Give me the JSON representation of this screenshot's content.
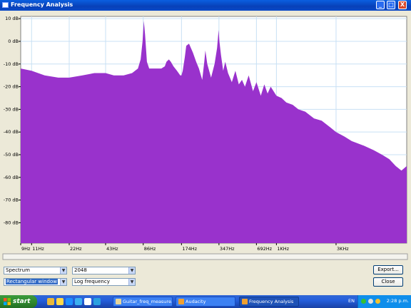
{
  "window": {
    "title": "Frequency Analysis",
    "minimize": "_",
    "maximize": "□",
    "close": "X"
  },
  "chart_data": {
    "type": "area",
    "title": "",
    "xlabel": "",
    "ylabel": "",
    "x_scale": "log",
    "x_unit": "Hz",
    "xlim": [
      9,
      11025
    ],
    "ylim": [
      -89,
      11
    ],
    "x_tick_values": [
      9,
      11,
      22,
      43,
      86,
      174,
      347,
      692,
      1000,
      3000
    ],
    "x_tick_labels": [
      "9Hz",
      "11Hz",
      "22Hz",
      "43Hz",
      "86Hz",
      "174Hz",
      "347Hz",
      "692Hz",
      "1KHz",
      "3KHz"
    ],
    "y_tick_values": [
      10,
      0,
      -10,
      -20,
      -30,
      -40,
      -50,
      -60,
      -70,
      -80
    ],
    "y_tick_labels": [
      "10 dB",
      "0 dB",
      "-10 dB",
      "-20 dB",
      "-30 dB",
      "-40 dB",
      "-50 dB",
      "-60 dB",
      "-70 dB",
      "-80 dB"
    ],
    "grid": true,
    "fill_color": "#9932CC",
    "background": "#FFFFFF",
    "grid_color": "#C8E0F4",
    "series": [
      {
        "x": [
          9,
          11,
          14,
          18,
          22,
          28,
          35,
          43,
          50,
          60,
          70,
          78,
          82,
          85,
          87,
          89,
          92,
          96,
          100,
          110,
          120,
          128,
          132,
          138,
          143,
          150,
          160,
          170,
          174,
          178,
          185,
          190,
          200,
          215,
          228,
          240,
          255,
          265,
          270,
          280,
          300,
          320,
          335,
          345,
          350,
          360,
          375,
          390,
          410,
          440,
          470,
          500,
          530,
          560,
          600,
          650,
          692,
          750,
          800,
          850,
          900,
          1000,
          1100,
          1200,
          1350,
          1500,
          1700,
          2000,
          2300,
          2700,
          3000,
          3500,
          4000,
          5000,
          6000,
          7000,
          8000,
          9000,
          10000,
          11025
        ],
        "y": [
          -12,
          -13,
          -15,
          -16,
          -16,
          -15,
          -14,
          -14,
          -15,
          -15,
          -14,
          -12,
          -8,
          0,
          9,
          3,
          -9,
          -12,
          -12,
          -12,
          -12,
          -11,
          -9,
          -8,
          -9,
          -11,
          -13,
          -15,
          -15,
          -13,
          -7,
          -2,
          -1,
          -5,
          -9,
          -12,
          -17,
          -9,
          -4,
          -10,
          -16,
          -10,
          -3,
          5,
          0,
          -6,
          -13,
          -9,
          -14,
          -18,
          -13,
          -19,
          -17,
          -20,
          -15,
          -22,
          -18,
          -24,
          -19,
          -23,
          -20,
          -24,
          -25,
          -27,
          -28,
          -30,
          -31,
          -34,
          -35,
          -38,
          -40,
          -42,
          -44,
          -46,
          -48,
          -50,
          -52,
          -55,
          -57,
          -55
        ]
      }
    ]
  },
  "controls": {
    "algorithm": "Spectrum",
    "size": "2048",
    "function": "Rectangular window",
    "axis": "Log frequency",
    "export": "Export...",
    "close": "Close",
    "dropdown_arrow": "▼"
  },
  "taskbar": {
    "start": "start",
    "tasks": [
      {
        "label": "Guitar_freq_measure...",
        "icon_color": "#E7D59A",
        "active": false
      },
      {
        "label": "Audacity",
        "icon_color": "#F0A030",
        "active": false
      },
      {
        "label": "Frequency Analysis",
        "icon_color": "#F0A030",
        "active": true
      }
    ],
    "language": "EN",
    "clock": "2:28 p.m.",
    "quick_launch_colors": [
      "#E8B83A",
      "#FFD94A",
      "#1E8FFF",
      "#3BB0F0",
      "#FFFFFF",
      "#2AA0E0"
    ]
  }
}
